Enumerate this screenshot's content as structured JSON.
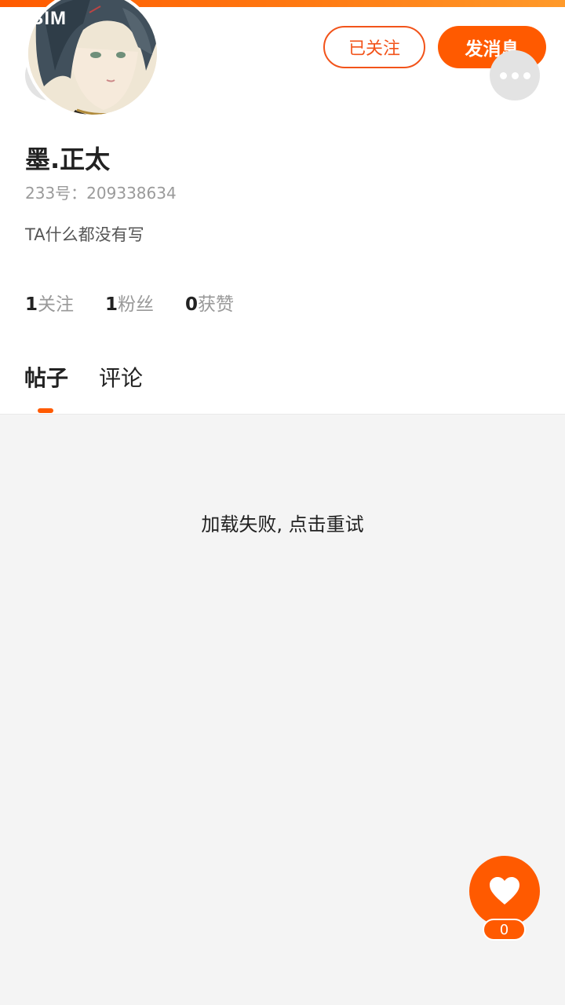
{
  "status_bar": {
    "carrier": "BIM"
  },
  "header": {
    "follow_label": "已关注",
    "message_label": "发消息",
    "back_icon": "chevron-left-icon",
    "more_icon": "more-dots-icon"
  },
  "profile": {
    "name": "墨.正太",
    "uid": "233号：209338634",
    "bio": "TA什么都没有写"
  },
  "stats": [
    {
      "num": "1",
      "label": "关注"
    },
    {
      "num": "1",
      "label": "粉丝"
    },
    {
      "num": "0",
      "label": "获赞"
    }
  ],
  "tabs": [
    {
      "label": "帖子",
      "active": true
    },
    {
      "label": "评论",
      "active": false
    }
  ],
  "content": {
    "error": "加载失败, 点击重试"
  },
  "like": {
    "count": "0",
    "icon": "heart-icon"
  },
  "colors": {
    "accent": "#ff5a00",
    "accent_border": "#f2531a",
    "content_bg": "#f4f4f4"
  }
}
